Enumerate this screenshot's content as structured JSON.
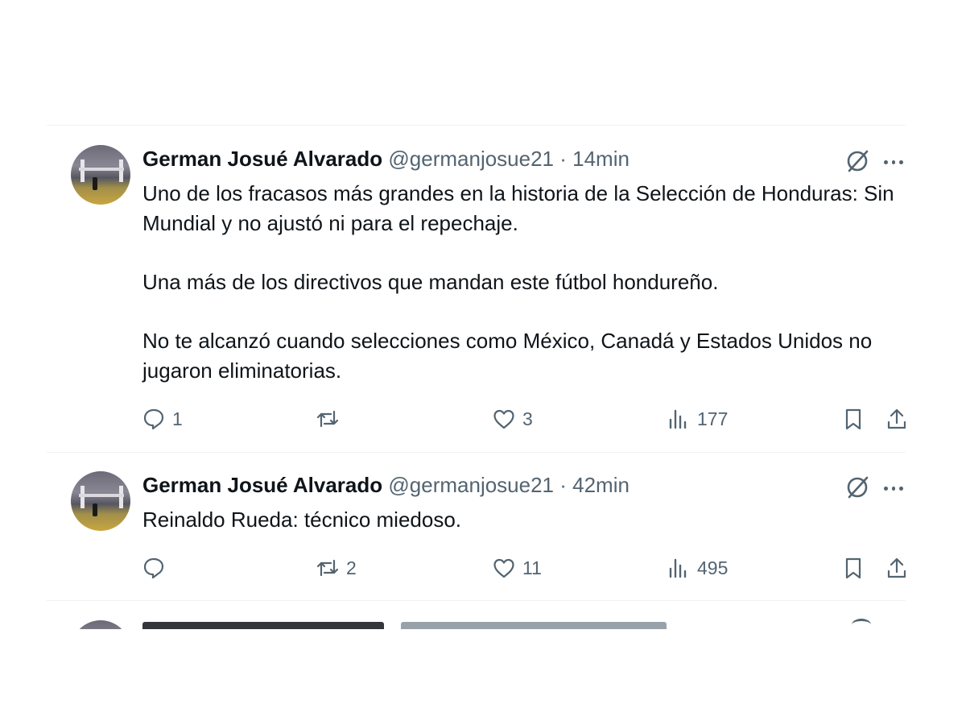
{
  "tweets": [
    {
      "author_name": "German Josué Alvarado",
      "meta": "@germanjosue21 · 14min",
      "paragraphs": [
        "Uno de los fracasos más grandes en la historia de la Selección de Honduras: Sin Mundial y no ajustó ni para el repechaje.",
        "Una más de los directivos que mandan este fútbol hondureño.",
        "No te alcanzó cuando selecciones como México, Canadá y Estados Unidos no jugaron eliminatorias."
      ],
      "replies": "1",
      "reposts": "",
      "likes": "3",
      "views": "177"
    },
    {
      "author_name": "German Josué Alvarado",
      "meta": "@germanjosue21 · 42min",
      "paragraphs": [
        "Reinaldo Rueda: técnico miedoso."
      ],
      "replies": "",
      "reposts": "2",
      "likes": "11",
      "views": "495"
    }
  ],
  "icons": {
    "reply": "reply-icon",
    "repost": "repost-icon",
    "like": "heart-icon",
    "views": "views-icon",
    "bookmark": "bookmark-icon",
    "share": "share-icon",
    "grok": "grok-icon",
    "more": "more-icon"
  },
  "colors": {
    "text": "#0f1419",
    "secondary": "#536471",
    "divider": "#eff3f4"
  }
}
